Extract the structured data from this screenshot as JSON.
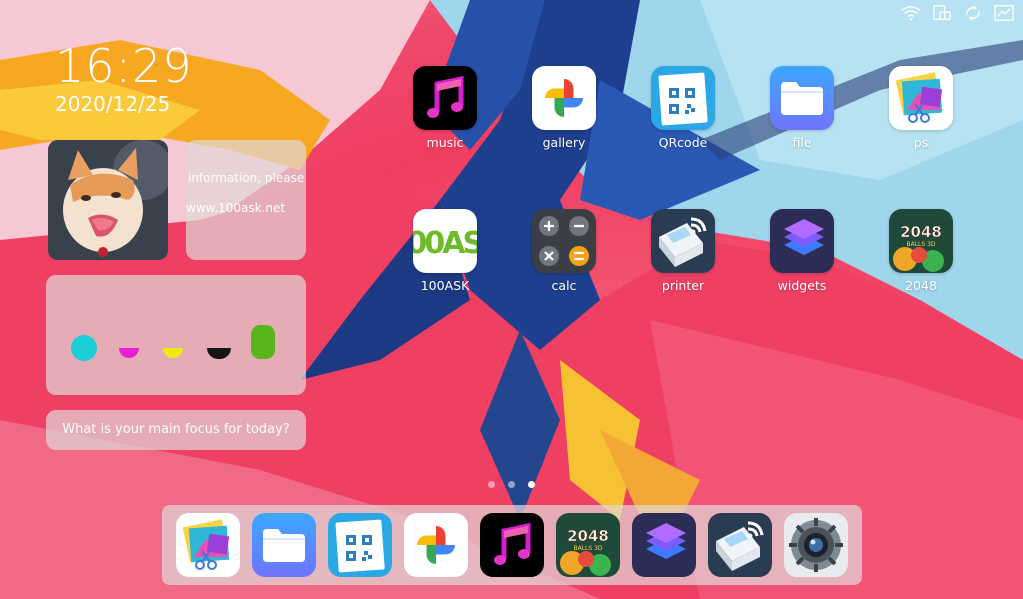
{
  "status_bar": {
    "icons": [
      "wifi-icon",
      "screen-rotate-icon",
      "sync-icon",
      "chart-icon"
    ]
  },
  "clock": {
    "time": "16:29",
    "date": "2020/12/25"
  },
  "widgets": {
    "info": {
      "line1": "information, please",
      "line2": "www.100ask.net"
    },
    "colors": [
      "#1ccfd6",
      "#e620d4",
      "#f1ea12",
      "#161616",
      "#58b51a"
    ],
    "focus": {
      "prompt": "What is your main focus for today?"
    }
  },
  "apps": [
    {
      "label": "music"
    },
    {
      "label": "gallery"
    },
    {
      "label": "QRcode"
    },
    {
      "label": "file"
    },
    {
      "label": "ps"
    },
    {
      "label": "100ASK"
    },
    {
      "label": "calc"
    },
    {
      "label": "printer"
    },
    {
      "label": "widgets"
    },
    {
      "label": "2048"
    }
  ],
  "app_icons": {
    "100ASK": "100ASK",
    "game_2048": "2048",
    "game_2048_sub": "BALLS 3D"
  },
  "page_indicator": {
    "pages": 3,
    "active": 3
  },
  "dock": [
    "ps",
    "file",
    "QRcode",
    "gallery",
    "music",
    "2048",
    "widgets",
    "printer",
    "settings"
  ]
}
